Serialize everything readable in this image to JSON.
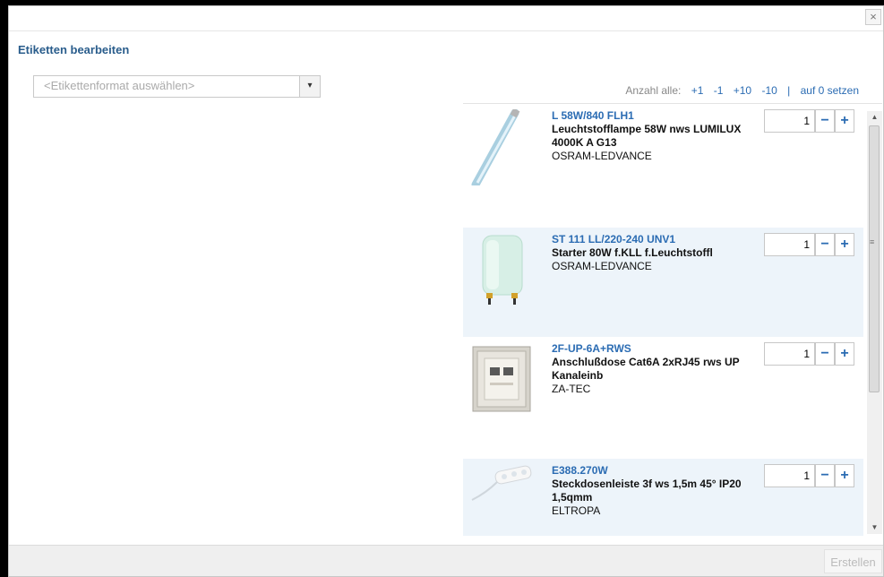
{
  "dialog": {
    "close_label": "×",
    "title": "Etiketten bearbeiten",
    "format_select": {
      "placeholder": "<Etikettenformat auswählen>"
    },
    "anzahl": {
      "label": "Anzahl alle:",
      "actions": [
        "+1",
        "-1",
        "+10",
        "-10"
      ],
      "separator": "|",
      "reset": "auf 0 setzen"
    },
    "items": [
      {
        "code": "L 58W/840 FLH1",
        "description": "Leuchtstofflampe 58W nws LUMILUX 4000K A G13",
        "manufacturer": "OSRAM-LEDVANCE",
        "qty": "1",
        "thumb": "fluorescent-tube-icon"
      },
      {
        "code": "ST 111 LL/220-240 UNV1",
        "description": "Starter 80W f.KLL f.Leuchtstoffl",
        "manufacturer": "OSRAM-LEDVANCE",
        "qty": "1",
        "thumb": "starter-icon"
      },
      {
        "code": "2F-UP-6A+RWS",
        "description": "Anschlußdose Cat6A 2xRJ45 rws UP Kanaleinb",
        "manufacturer": "ZA-TEC",
        "qty": "1",
        "thumb": "network-socket-icon"
      },
      {
        "code": "E388.270W",
        "description": "Steckdosenleiste 3f ws 1,5m 45° IP20 1,5qmm",
        "manufacturer": "ELTROPA",
        "qty": "1",
        "thumb": "power-strip-icon"
      }
    ],
    "qty_minus": "−",
    "qty_plus": "+",
    "scroll_up": "▲",
    "scroll_down": "▼",
    "scroll_grip": "≡",
    "create_button": "Erstellen",
    "select_arrow": "▾"
  }
}
